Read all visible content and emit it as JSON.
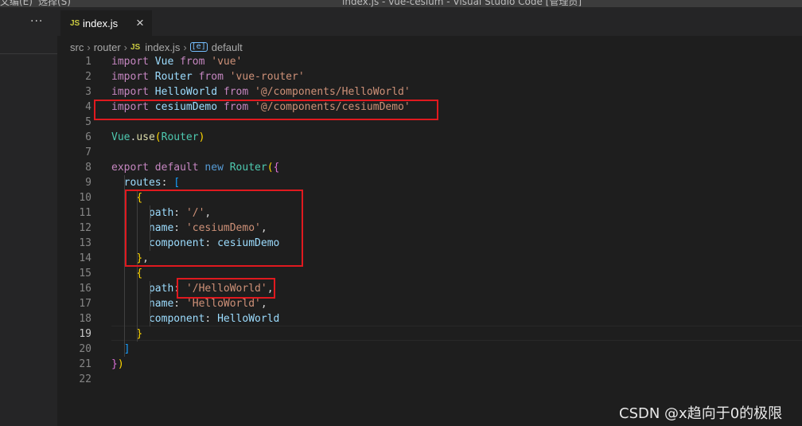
{
  "titlebar": {
    "menu_edit": "文编(E)",
    "menu_select": "选择(S)",
    "window_title": "index.js - vue-cesium - Visual Studio Code [管理员]"
  },
  "sidebar": {
    "more_label": "···"
  },
  "tab": {
    "icon": "js-file-icon",
    "icon_text": "JS",
    "name": "index.js",
    "close": "×"
  },
  "breadcrumb": {
    "items": [
      "src",
      "router",
      "index.js",
      "default"
    ],
    "file_icon_text": "JS",
    "symbol_icon_text": "[e]"
  },
  "editor": {
    "active_line": 19,
    "line_numbers": [
      "1",
      "2",
      "3",
      "4",
      "5",
      "6",
      "7",
      "8",
      "9",
      "10",
      "11",
      "12",
      "13",
      "14",
      "15",
      "16",
      "17",
      "18",
      "19",
      "20",
      "21",
      "22"
    ],
    "lines": [
      [
        [
          "kw",
          "import"
        ],
        [
          "p",
          " "
        ],
        [
          "id",
          "Vue"
        ],
        [
          "p",
          " "
        ],
        [
          "kw",
          "from"
        ],
        [
          "p",
          " "
        ],
        [
          "str",
          "'vue'"
        ]
      ],
      [
        [
          "kw",
          "import"
        ],
        [
          "p",
          " "
        ],
        [
          "id",
          "Router"
        ],
        [
          "p",
          " "
        ],
        [
          "kw",
          "from"
        ],
        [
          "p",
          " "
        ],
        [
          "str",
          "'vue-router'"
        ]
      ],
      [
        [
          "kw",
          "import"
        ],
        [
          "p",
          " "
        ],
        [
          "id",
          "HelloWorld"
        ],
        [
          "p",
          " "
        ],
        [
          "kw",
          "from"
        ],
        [
          "p",
          " "
        ],
        [
          "str",
          "'@/components/HelloWorld'"
        ]
      ],
      [
        [
          "kw",
          "import"
        ],
        [
          "p",
          " "
        ],
        [
          "id",
          "cesiumDemo"
        ],
        [
          "p",
          " "
        ],
        [
          "kw",
          "from"
        ],
        [
          "p",
          " "
        ],
        [
          "str",
          "'@/components/cesiumDemo'"
        ]
      ],
      [],
      [
        [
          "cls",
          "Vue"
        ],
        [
          "p",
          "."
        ],
        [
          "fn",
          "use"
        ],
        [
          "br",
          "("
        ],
        [
          "cls",
          "Router"
        ],
        [
          "br",
          ")"
        ]
      ],
      [],
      [
        [
          "kw",
          "export"
        ],
        [
          "p",
          " "
        ],
        [
          "kw",
          "default"
        ],
        [
          "p",
          " "
        ],
        [
          "kb",
          "new"
        ],
        [
          "p",
          " "
        ],
        [
          "cls",
          "Router"
        ],
        [
          "br",
          "("
        ],
        [
          "br2",
          "{"
        ]
      ],
      [
        [
          "p",
          "  "
        ],
        [
          "id",
          "routes"
        ],
        [
          "p",
          ": "
        ],
        [
          "br3",
          "["
        ]
      ],
      [
        [
          "p",
          "    "
        ],
        [
          "br",
          "{"
        ]
      ],
      [
        [
          "p",
          "      "
        ],
        [
          "id",
          "path"
        ],
        [
          "p",
          ": "
        ],
        [
          "str",
          "'/'"
        ],
        [
          "p",
          ","
        ]
      ],
      [
        [
          "p",
          "      "
        ],
        [
          "id",
          "name"
        ],
        [
          "p",
          ": "
        ],
        [
          "str",
          "'cesiumDemo'"
        ],
        [
          "p",
          ","
        ]
      ],
      [
        [
          "p",
          "      "
        ],
        [
          "id",
          "component"
        ],
        [
          "p",
          ": "
        ],
        [
          "id",
          "cesiumDemo"
        ]
      ],
      [
        [
          "p",
          "    "
        ],
        [
          "br",
          "}"
        ],
        [
          "p",
          ","
        ]
      ],
      [
        [
          "p",
          "    "
        ],
        [
          "br",
          "{"
        ]
      ],
      [
        [
          "p",
          "      "
        ],
        [
          "id",
          "path"
        ],
        [
          "p",
          ": "
        ],
        [
          "str",
          "'/HelloWorld'"
        ],
        [
          "p",
          ","
        ]
      ],
      [
        [
          "p",
          "      "
        ],
        [
          "id",
          "name"
        ],
        [
          "p",
          ": "
        ],
        [
          "str",
          "'HelloWorld'"
        ],
        [
          "p",
          ","
        ]
      ],
      [
        [
          "p",
          "      "
        ],
        [
          "id",
          "component"
        ],
        [
          "p",
          ": "
        ],
        [
          "id",
          "HelloWorld"
        ]
      ],
      [
        [
          "p",
          "    "
        ],
        [
          "br",
          "}"
        ]
      ],
      [
        [
          "p",
          "  "
        ],
        [
          "br3",
          "]"
        ]
      ],
      [
        [
          "br2",
          "}"
        ],
        [
          "br",
          ")"
        ]
      ],
      []
    ]
  },
  "annotations": {
    "box_color": "#e0191f"
  },
  "watermark": {
    "text": "CSDN @x趋向于0的极限"
  },
  "colors": {
    "background": "#1e1e1e",
    "sidebar": "#252526",
    "keyword": "#c586c0",
    "string": "#ce9178",
    "variable": "#9cdcfe",
    "class": "#4ec9b0"
  }
}
